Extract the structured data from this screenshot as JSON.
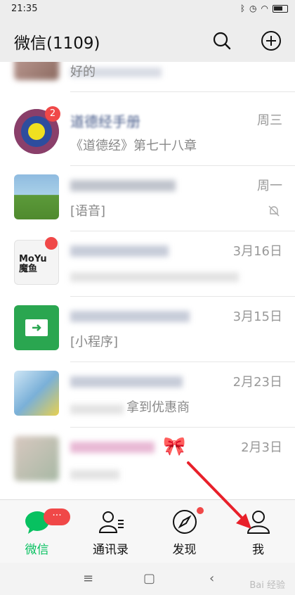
{
  "status_bar": {
    "time": "21:35"
  },
  "app_bar": {
    "title": "微信(1109)"
  },
  "chats": [
    {
      "name": "",
      "preview": "好的",
      "time": ""
    },
    {
      "name": "道德经手册",
      "preview": "《道德经》第七十八章",
      "time": "周三",
      "badge": "2"
    },
    {
      "name": "",
      "preview": "[语音]",
      "time": "周一",
      "muted": true
    },
    {
      "name": "",
      "preview": "",
      "time": "3月16日",
      "avatar_text": "MoYu 魔鱼文化"
    },
    {
      "name": "",
      "preview": "[小程序]",
      "time": "3月15日"
    },
    {
      "name": "",
      "preview": "拿到优惠商",
      "time": "2月23日"
    },
    {
      "name": "🎀",
      "preview": "",
      "time": "2月3日"
    }
  ],
  "tabs": [
    {
      "label": "微信",
      "active": true,
      "badge": "···"
    },
    {
      "label": "通讯录"
    },
    {
      "label": "发现"
    },
    {
      "label": "我"
    }
  ],
  "watermark": "Bai 经验",
  "colors": {
    "accent": "#07c160",
    "badge": "#f04848",
    "annotation": "#e8202a"
  }
}
